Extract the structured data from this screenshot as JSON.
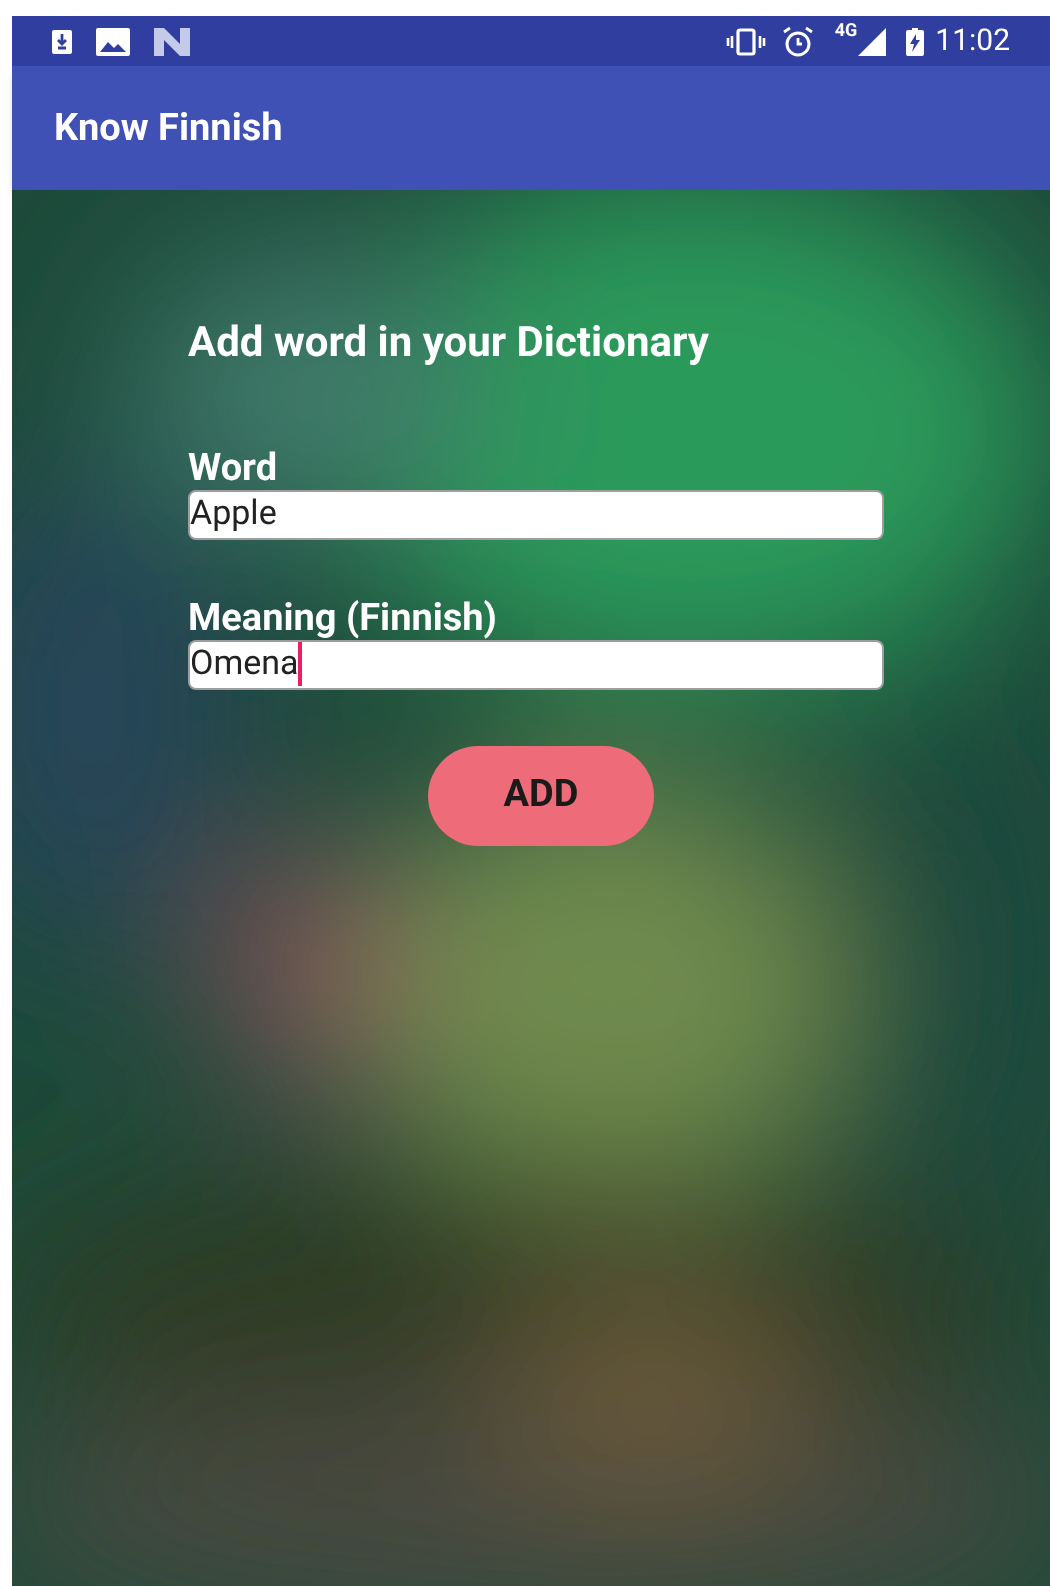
{
  "status_bar": {
    "network_label": "4G",
    "time": "11:02"
  },
  "app_bar": {
    "title": "Know Finnish"
  },
  "form": {
    "heading": "Add word in your Dictionary",
    "fields": [
      {
        "label": "Word",
        "value": "Apple",
        "focused": false
      },
      {
        "label": "Meaning (Finnish)",
        "value": "Omena",
        "focused": true
      }
    ],
    "button": "ADD"
  }
}
